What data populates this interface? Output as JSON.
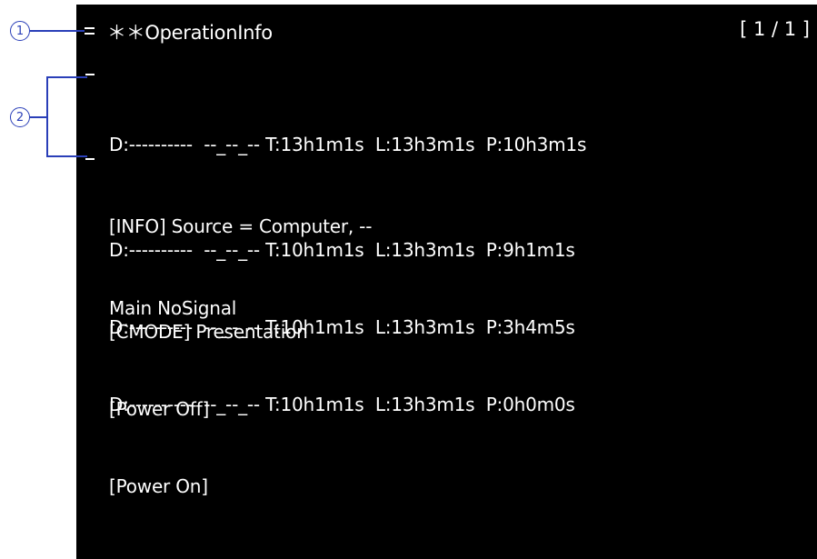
{
  "callouts": {
    "one": "1",
    "two": "2"
  },
  "header": {
    "title": "＊＊OperationInfo",
    "page": "[ 1 / 1 ]"
  },
  "entries": [
    {
      "line1": "D:----------  --_--_-- T:13h1m1s  L:13h3m1s  P:10h3m1s",
      "line2": "[INFO] Source = Computer, --",
      "line3": "Main NoSignal"
    },
    {
      "line1": "D:----------  --_--_-- T:10h1m1s  L:13h3m1s  P:9h1m1s",
      "line2": "[CMODE] Presentation"
    },
    {
      "line1": "D:----------  --_--_-- T:10h1m1s  L:13h3m1s  P:3h4m5s",
      "line2": "[Power Off]"
    },
    {
      "line1": "D:----------  --_--_-- T:10h1m1s  L:13h3m1s  P:0h0m0s",
      "line2": "[Power On]"
    }
  ],
  "colors": {
    "background": "#000000",
    "text": "#ffffff",
    "callout": "#2a3fb8"
  }
}
